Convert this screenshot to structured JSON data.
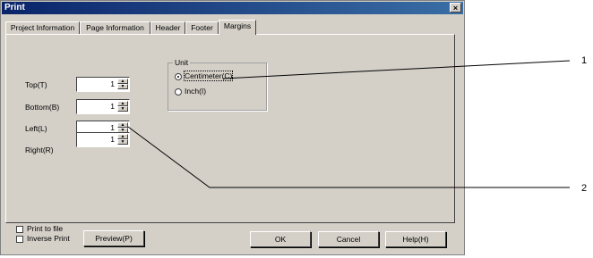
{
  "window": {
    "title": "Print",
    "close_glyph": "×"
  },
  "tabs": [
    {
      "label": "Project Information"
    },
    {
      "label": "Page Information"
    },
    {
      "label": "Header"
    },
    {
      "label": "Footer"
    },
    {
      "label": "Margins",
      "active": true
    }
  ],
  "margins": {
    "top": {
      "label": "Top(T)",
      "value": "1"
    },
    "bottom": {
      "label": "Bottom(B)",
      "value": "1"
    },
    "left": {
      "label": "Left(L)",
      "value": "1"
    },
    "right": {
      "label": "Right(R)",
      "value": "1"
    }
  },
  "unit": {
    "group_label": "Unit",
    "options": [
      {
        "label": "Centimeter(C)",
        "selected": true
      },
      {
        "label": "Inch(I)",
        "selected": false
      }
    ]
  },
  "footer": {
    "print_to_file": "Print to file",
    "inverse_print": "Inverse Print",
    "preview": "Preview(P)",
    "ok": "OK",
    "cancel": "Cancel",
    "help": "Help(H)"
  },
  "callouts": [
    "1",
    "2"
  ],
  "colors": {
    "dialog_bg": "#d4d0c8",
    "title_bar": "#0a246a"
  }
}
